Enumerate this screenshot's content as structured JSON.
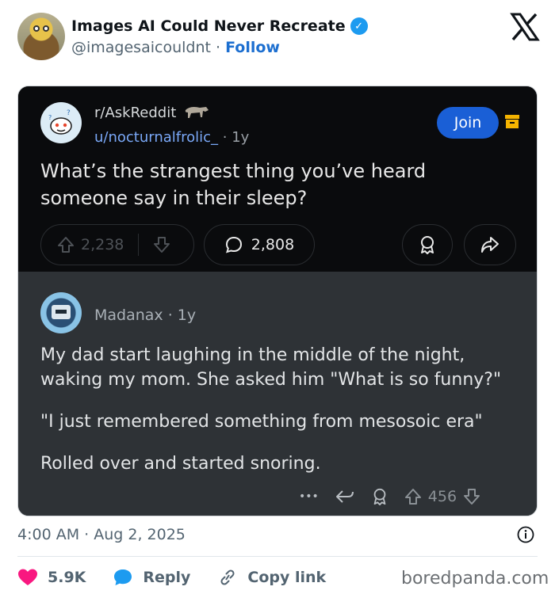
{
  "tweet": {
    "display_name": "Images AI Could Never Recreate",
    "handle": "@imagesaicouldnt",
    "follow_label": "Follow",
    "separator": "·",
    "timestamp": "4:00 AM · Aug 2, 2025",
    "likes": "5.9K",
    "reply_label": "Reply",
    "copy_link_label": "Copy link"
  },
  "reddit_post": {
    "subreddit": "r/AskReddit",
    "username": "u/nocturnalfrolic_",
    "age": "· 1y",
    "join_label": "Join",
    "title": "What’s the strangest thing you’ve heard someone say in their sleep?",
    "upvotes": "2,238",
    "comments": "2,808"
  },
  "reddit_comment": {
    "username": "Madanax",
    "age": "· 1y",
    "paragraphs": [
      "My dad start laughing in the middle of the night, waking my mom. She asked him \"What is so funny?\"",
      "\"I just remembered something from mesosoic era\"",
      "Rolled over and started snoring."
    ],
    "more_label": "•••",
    "upvotes": "456"
  },
  "watermark": "boredpanda.com",
  "colors": {
    "verified": "#1d9bf0",
    "follow": "#1d6fd0",
    "join": "#1a5fd6",
    "like": "#f91880",
    "reply": "#1d9bf0"
  }
}
